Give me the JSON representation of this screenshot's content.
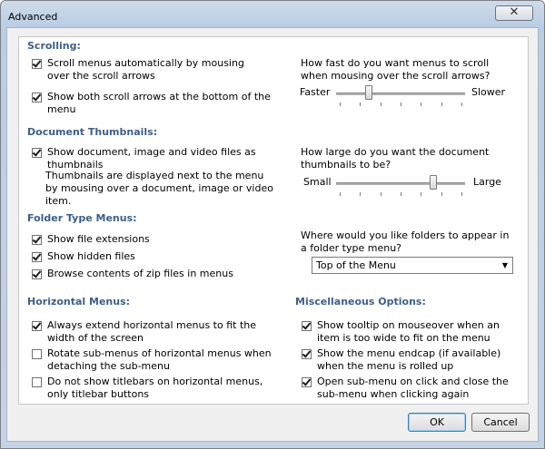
{
  "window": {
    "title": "Advanced",
    "close_glyph": "✕"
  },
  "scrolling": {
    "heading": "Scrolling:",
    "auto_scroll": {
      "label": "Scroll menus automatically by mousing over the scroll arrows",
      "checked": true
    },
    "both_arrows": {
      "label": "Show both scroll arrows at the bottom of the menu",
      "checked": true
    },
    "speed_question": "How fast do you want menus to scroll when mousing over the scroll arrows?",
    "speed_min_label": "Faster",
    "speed_max_label": "Slower",
    "speed_value": 0.25
  },
  "thumbnails": {
    "heading": "Document Thumbnails:",
    "show_thumbs": {
      "label": "Show document, image and video files as thumbnails",
      "checked": true
    },
    "description": "Thumbnails are displayed next to the menu by mousing over a document, image or video item.",
    "size_question": "How large do you want the document thumbnails to be?",
    "size_min_label": "Small",
    "size_max_label": "Large",
    "size_value": 0.75
  },
  "folder_menus": {
    "heading": "Folder Type Menus:",
    "file_extensions": {
      "label": "Show file extensions",
      "checked": true
    },
    "hidden_files": {
      "label": "Show hidden files",
      "checked": true
    },
    "zip_contents": {
      "label": "Browse contents of zip files in menus",
      "checked": true
    },
    "position_question": "Where would you like folders to appear in a folder type menu?",
    "position_selected": "Top of the Menu"
  },
  "horizontal_menus": {
    "heading": "Horizontal Menus:",
    "extend_width": {
      "label": "Always extend horizontal menus to fit the width of the screen",
      "checked": true
    },
    "rotate_submenus": {
      "label": "Rotate sub-menus of horizontal menus when detaching the sub-menu",
      "checked": false
    },
    "no_titlebars": {
      "label": "Do not show titlebars on horizontal menus, only titlebar buttons",
      "checked": false
    }
  },
  "misc": {
    "heading": "Miscellaneous Options:",
    "tooltip": {
      "label": "Show tooltip on mouseover when an item is too wide to fit on the menu",
      "checked": true
    },
    "endcap": {
      "label": "Show the menu endcap (if available) when the menu is rolled up",
      "checked": true
    },
    "click_submenu": {
      "label": "Open sub-menu on click and close the sub-menu when clicking again",
      "checked": true
    }
  },
  "buttons": {
    "ok": "OK",
    "cancel": "Cancel"
  },
  "colors": {
    "heading": "#3e5f8a",
    "titlebar": "#b9cde4",
    "dialog_bg": "#f0f0f0"
  }
}
